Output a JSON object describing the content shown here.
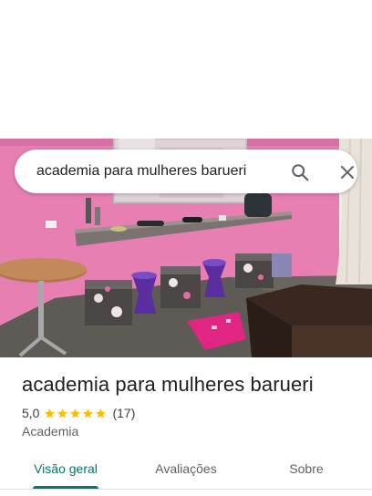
{
  "search": {
    "query": "academia para mulheres barueri"
  },
  "place": {
    "title": "academia para mulheres barueri",
    "rating": "5,0",
    "stars": 5,
    "review_count": "(17)",
    "category": "Academia"
  },
  "tabs": [
    {
      "label": "Visão geral",
      "active": true
    },
    {
      "label": "Avaliações",
      "active": false
    },
    {
      "label": "Sobre",
      "active": false
    }
  ],
  "colors": {
    "accent": "#00796b",
    "star": "#fbbc04",
    "wall": "#e77fb3"
  },
  "icons": [
    "search-icon",
    "close-icon",
    "star-icon"
  ]
}
